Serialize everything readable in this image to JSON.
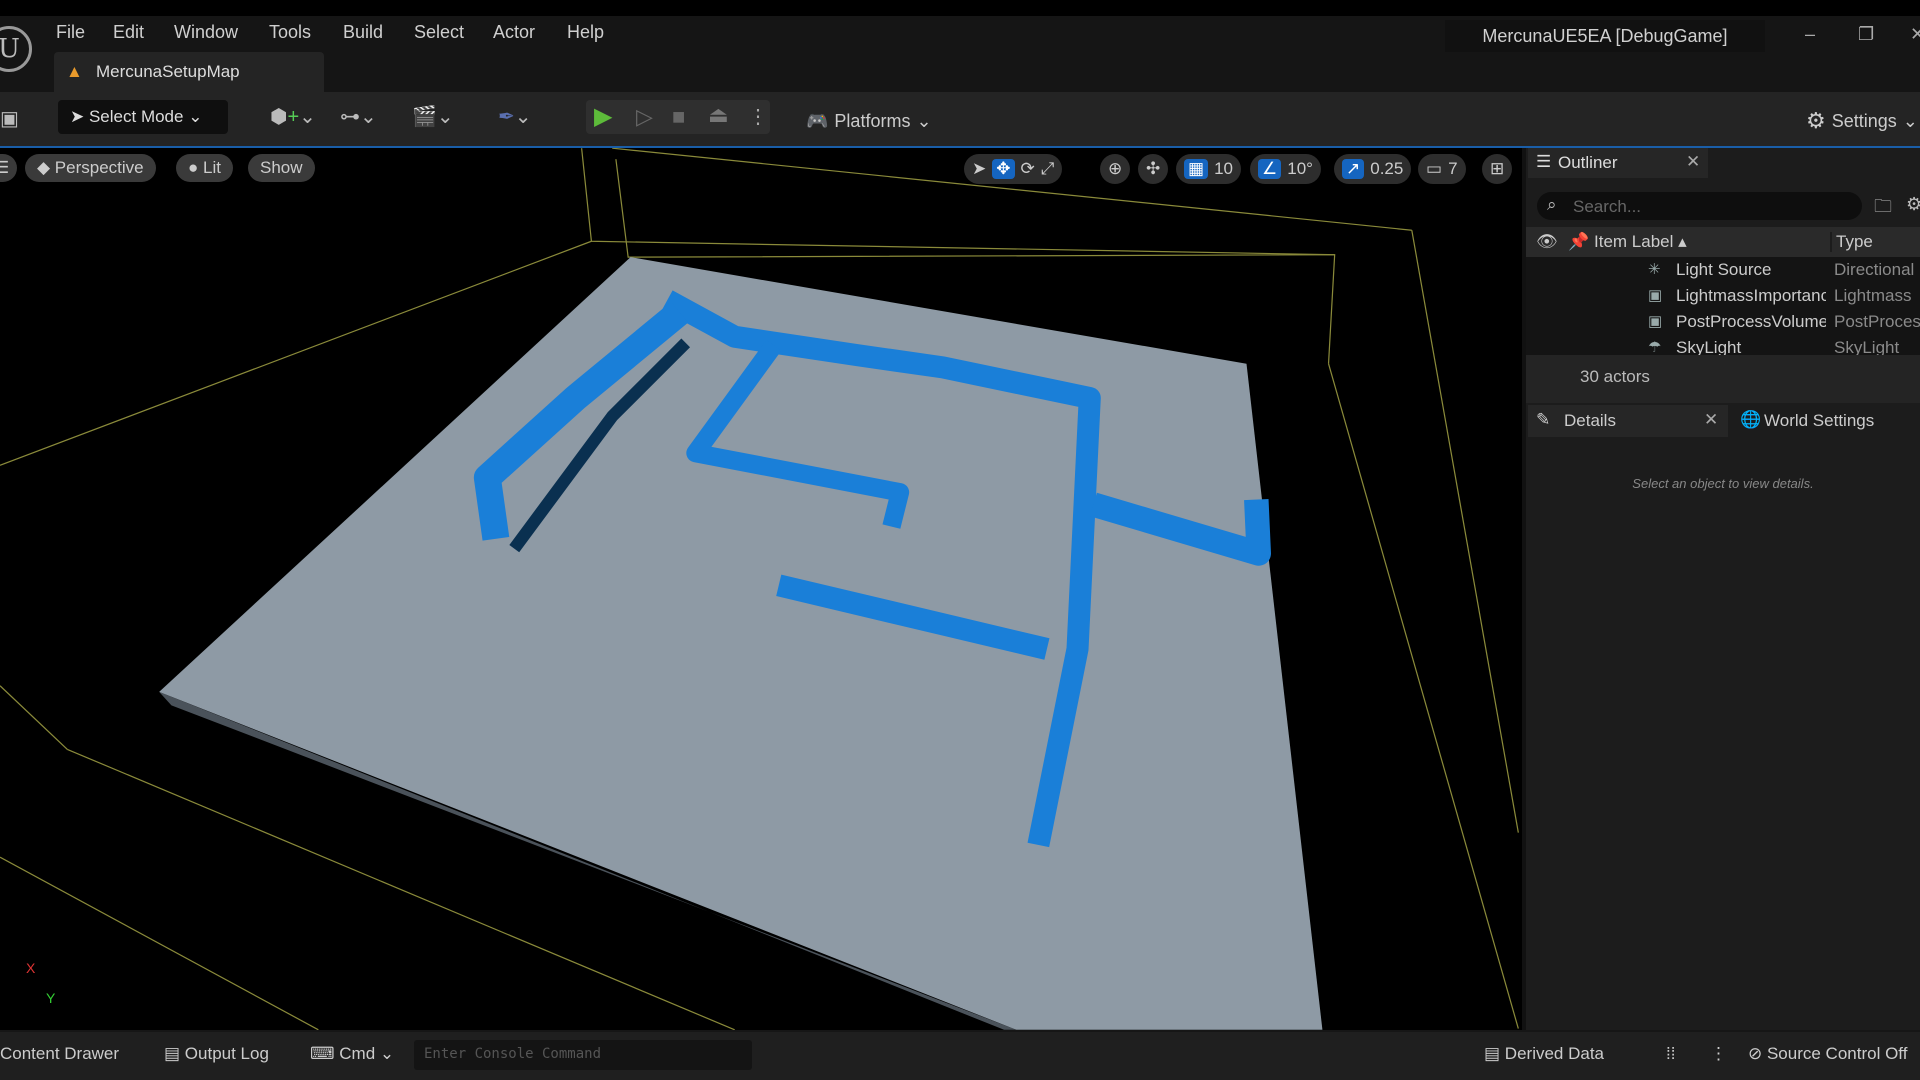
{
  "menu": [
    "File",
    "Edit",
    "Window",
    "Tools",
    "Build",
    "Select",
    "Actor",
    "Help"
  ],
  "map_tab": "MercunaSetupMap",
  "app_title": "MercunaUE5EA [DebugGame]",
  "window_controls": {
    "minimize": "–",
    "restore": "❐",
    "close": "✕"
  },
  "toolbar": {
    "select_mode": "Select Mode",
    "platforms": "Platforms",
    "settings": "Settings"
  },
  "viewport": {
    "perspective": "Perspective",
    "lit": "Lit",
    "show": "Show",
    "grid_snap": "10",
    "rotation_snap": "10°",
    "scale_snap": "0.25",
    "camera_speed": "7",
    "axis_x": "X",
    "axis_y": "Y",
    "accent": "#1a7fd8"
  },
  "outliner": {
    "title": "Outliner",
    "search_placeholder": "Search...",
    "col_label": "Item Label",
    "col_type": "Type",
    "rows": [
      {
        "label": "Light Source",
        "type": "Directional"
      },
      {
        "label": "LightmassImportance",
        "type": "Lightmass"
      },
      {
        "label": "PostProcessVolume",
        "type": "PostProcess"
      },
      {
        "label": "SkyLight",
        "type": "SkyLight"
      }
    ],
    "count": "30 actors"
  },
  "details": {
    "title": "Details",
    "world_settings": "World Settings",
    "hint": "Select an object to view details."
  },
  "status": {
    "content_drawer": "Content Drawer",
    "output_log": "Output Log",
    "cmd": "Cmd",
    "console_placeholder": "Enter Console Command",
    "derived_data": "Derived Data",
    "source_control": "Source Control Off"
  }
}
